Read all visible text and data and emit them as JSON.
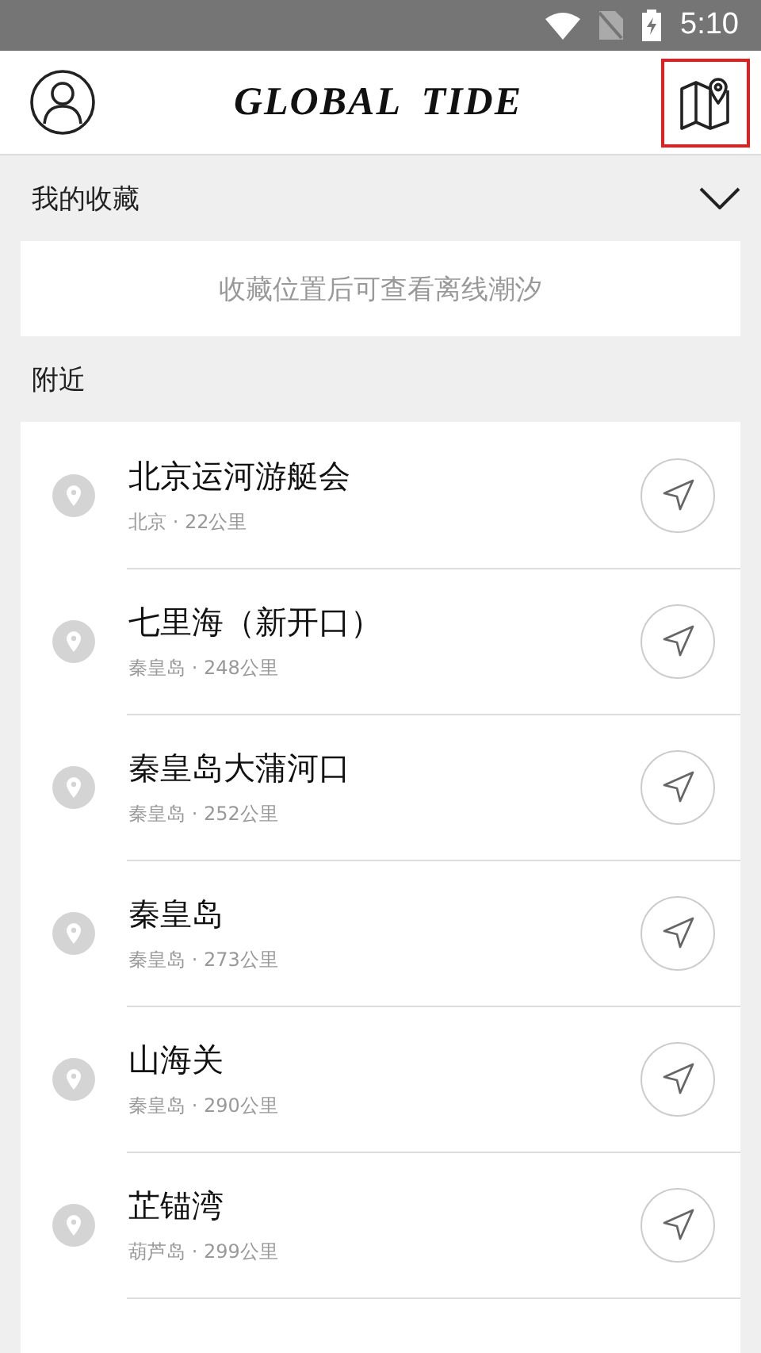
{
  "status_bar": {
    "time": "5:10"
  },
  "header": {
    "title": "GLOBAL TIDE",
    "map_button_highlighted": true
  },
  "favorites": {
    "title": "我的收藏",
    "expanded": true,
    "empty_message": "收藏位置后可查看离线潮汐"
  },
  "nearby": {
    "title": "附近",
    "items": [
      {
        "name": "北京运河游艇会",
        "detail": "北京 · 22公里"
      },
      {
        "name": "七里海（新开口）",
        "detail": "秦皇岛 · 248公里"
      },
      {
        "name": "秦皇岛大蒲河口",
        "detail": "秦皇岛 · 252公里"
      },
      {
        "name": "秦皇岛",
        "detail": "秦皇岛 · 273公里"
      },
      {
        "name": "山海关",
        "detail": "秦皇岛 · 290公里"
      },
      {
        "name": "芷锚湾",
        "detail": "葫芦岛 · 299公里"
      }
    ]
  }
}
